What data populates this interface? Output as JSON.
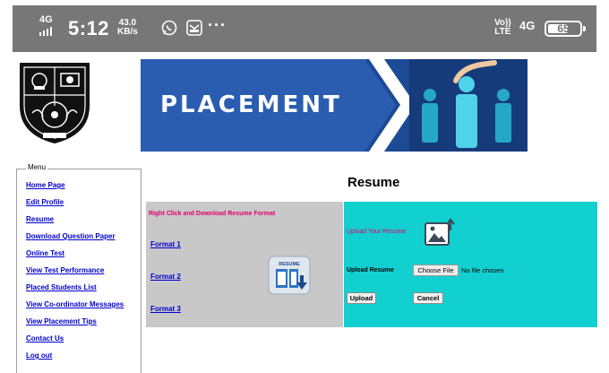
{
  "status_bar": {
    "network": "4G",
    "time": "5:12",
    "speed_value": "43.0",
    "speed_unit": "KB/s",
    "more": "···",
    "volte_top": "Vo))",
    "volte_bottom": "LTE",
    "network_right": "4G",
    "battery": "65",
    "battery_level_percent": 65
  },
  "banner": {
    "text": "PLACEMENT"
  },
  "menu": {
    "legend": "Menu",
    "items": [
      "Home Page",
      "Edit Profile",
      "Resume",
      "Download Question Paper",
      "Online Test",
      "View Test Performance",
      "Placed Students List",
      "View Co-ordinator Messages",
      "View Placement Tips",
      "Contact Us",
      "Log out"
    ]
  },
  "page_title": "Resume",
  "format_panel": {
    "heading": "Right Click and Download Resume Format",
    "links": [
      "Format 1",
      "Format 2",
      "Format 3"
    ],
    "icon_label": "RESUME"
  },
  "upload_panel": {
    "heading": "Upload Your Resume",
    "field_label": "Upload Resume",
    "choose_button": "Choose File",
    "file_status": "No file chosen",
    "upload_button": "Upload",
    "cancel_button": "Cancel"
  },
  "colors": {
    "status_bar": "#777777",
    "banner": "#1d4a94",
    "link": "#0000cc",
    "heading_pink": "#e0006c",
    "format_panel": "#c8c8c8",
    "upload_panel": "#12d0d0"
  }
}
